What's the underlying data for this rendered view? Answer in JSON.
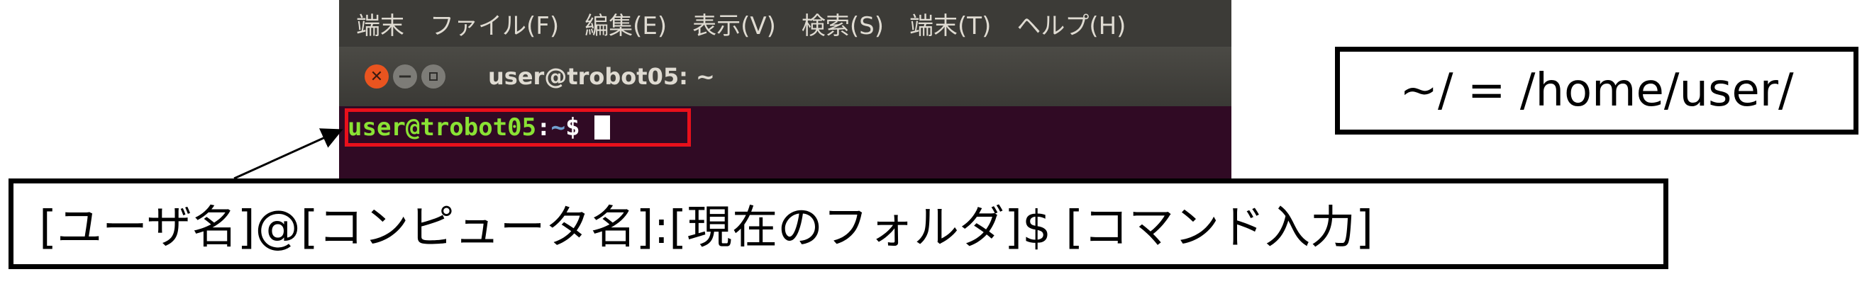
{
  "terminal": {
    "menu": [
      "端末",
      "ファイル(F)",
      "編集(E)",
      "表示(V)",
      "検索(S)",
      "端末(T)",
      "ヘルプ(H)"
    ],
    "window_title": "user@trobot05: ~",
    "prompt": {
      "user_host": "user@trobot05",
      "separator": ":",
      "path": "~",
      "symbol": "$"
    }
  },
  "annotations": {
    "home_note": "~/ = /home/user/",
    "format_note": "[ユーザ名]@[コンピュータ名]:[現在のフォルダ]$ [コマンド入力]"
  },
  "colors": {
    "terminal_bg": "#300a24",
    "highlight": "#e8101b",
    "prompt_user": "#8ae234",
    "prompt_path": "#729fcf"
  },
  "icons": [
    "close-icon",
    "minimize-icon",
    "maximize-icon",
    "arrow-icon"
  ]
}
